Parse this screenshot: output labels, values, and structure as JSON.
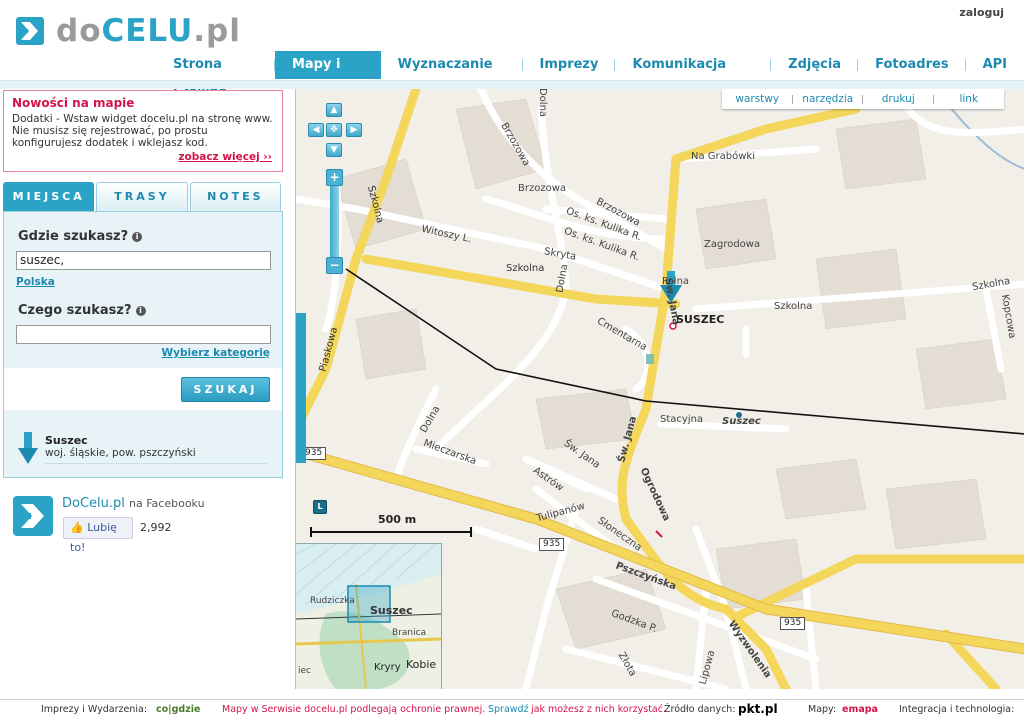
{
  "header": {
    "logo_text_start": "do",
    "logo_text_accent": "CELU",
    "logo_text_end": ".pl",
    "login": "zaloguj"
  },
  "nav": {
    "items": [
      {
        "label": "Strona Główna"
      },
      {
        "label": "Mapy i firmy",
        "active": true
      },
      {
        "label": "Wyznaczanie trasy"
      },
      {
        "label": "Imprezy"
      },
      {
        "label": "Komunikacja miejska"
      },
      {
        "label": "Zdjęcia"
      },
      {
        "label": "Fotoadres"
      },
      {
        "label": "API"
      }
    ]
  },
  "news": {
    "title": "Nowości na mapie",
    "text": "Dodatki - Wstaw widget docelu.pl na stronę www. Nie musisz się rejestrować, po prostu konfigurujesz dodatek i wklejasz kod.",
    "more": "zobacz więcej ››"
  },
  "tabs": [
    "MIEJSCA",
    "TRASY",
    "NOTES"
  ],
  "search": {
    "where_label": "Gdzie szukasz?",
    "where_value": "suszec,",
    "country_link": "Polska",
    "what_label": "Czego szukasz?",
    "what_value": "",
    "category_link": "Wybierz kategorię",
    "button": "SZUKAJ"
  },
  "result": {
    "name": "Suszec",
    "desc": "woj. śląskie, pow. pszczyński"
  },
  "facebook": {
    "title": "DoCelu.pl",
    "title_suffix": "na Facebooku",
    "like": "Lubię to!",
    "count": "2,992"
  },
  "map": {
    "toolbar": [
      "warstwy",
      "narzędzia",
      "drukuj",
      "link"
    ],
    "scale": "500 m",
    "layer_badge": "L",
    "streets": {
      "na_grabowki": "Na Grabówki",
      "brzozowa1": "Brzozowa",
      "brzozowa2": "Brzozowa",
      "brzozowa3": "Brzozowa",
      "kulika1": "Os. ks. Kulika R.",
      "kulika2": "Os. ks. Kulika R.",
      "zagrodowa": "Zagrodowa",
      "witoszy": "Witoszy L.",
      "skryta": "Skryta",
      "szkolna_left": "Szkolna",
      "szkolna_mid": "Szkolna",
      "szkolna_right1": "Szkolna",
      "szkolna_right2": "Szkolna",
      "cmentarna": "Cmentarna",
      "dolna1": "Dolna",
      "dolna2": "Dolna",
      "dolna3": "Dolna",
      "piaskowa": "Piaskowa",
      "sw_jana1": "Św. Jana",
      "sw_jana2": "Św. Jana",
      "sw_jana3": "Św. Jana",
      "polna": "Polna",
      "stacyjna": "Stacyjna",
      "suszec_station": "Suszec",
      "mieczarska": "Mieczarska",
      "astrow": "Astrów",
      "ogrodowa": "Ogrodowa",
      "tulipanow": "Tulipanów",
      "sloneczna": "Słoneczna",
      "pszczynska": "Pszczyńska",
      "godzka": "Godzka P.",
      "zlota": "Złota",
      "lipowa": "Lipowa",
      "wyzwolenia": "Wyzwolenia",
      "kopcowa": "Kopcowa",
      "szkolna_top": "Szkolna"
    },
    "city_label": "SUSZEC",
    "road_numbers": [
      "935",
      "935",
      "935"
    ],
    "minimap": {
      "rudziczka": "Rudziczka",
      "suszec": "Suszec",
      "branica": "Branica",
      "kryry": "Kryry",
      "kobie": "Kobie",
      "piec": "iec"
    }
  },
  "footer": {
    "events_label": "Imprezy i Wydarzenia:",
    "events_brand": "co|gdzie",
    "copyright_red": "Mapy w Serwisie docelu.pl podlegają ochronie prawnej.",
    "check": "Sprawdź",
    "check_rest": "jak możesz z nich korzystać.",
    "source_label": "Źródło danych:",
    "source_brand": "pkt.pl",
    "maps_label": "Mapy:",
    "maps_brand": "emapa",
    "integration": "Integracja i technologia:"
  }
}
